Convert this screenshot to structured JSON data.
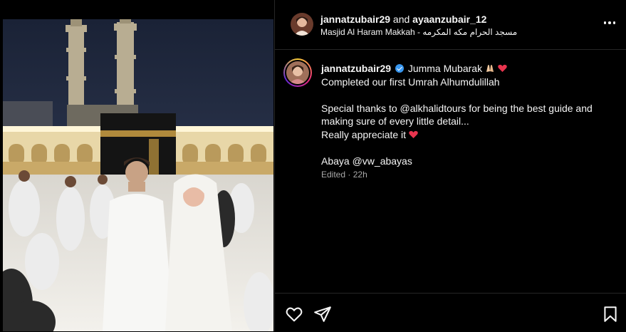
{
  "header": {
    "user1": "jannatzubair29",
    "and_text": "and",
    "user2": "ayaanzubair_12",
    "location": "Masjid Al Haram Makkah - مسجد الحرام مكه المكرمه"
  },
  "caption": {
    "username": "jannatzubair29",
    "first_line": "Jumma Mubarak",
    "line2": "Completed our first Umrah Alhumdulillah",
    "line3": "Special thanks to @alkhalidtours for being the best guide and",
    "line4": "making sure of every little detail...",
    "line5": "Really appreciate it",
    "line6": "Abaya @vw_abayas"
  },
  "meta": {
    "edited": "Edited",
    "separator": "·",
    "time": "22h"
  },
  "icons": {
    "verified": "verified-badge-icon",
    "more": "more-options-icon",
    "like": "heart-outline-icon",
    "share": "paper-plane-icon",
    "save": "bookmark-icon"
  },
  "colors": {
    "background": "#000000",
    "text": "#f5f5f5",
    "muted": "#a8a8a8",
    "verified": "#3897f0",
    "heart_emoji": "#e8344e"
  }
}
